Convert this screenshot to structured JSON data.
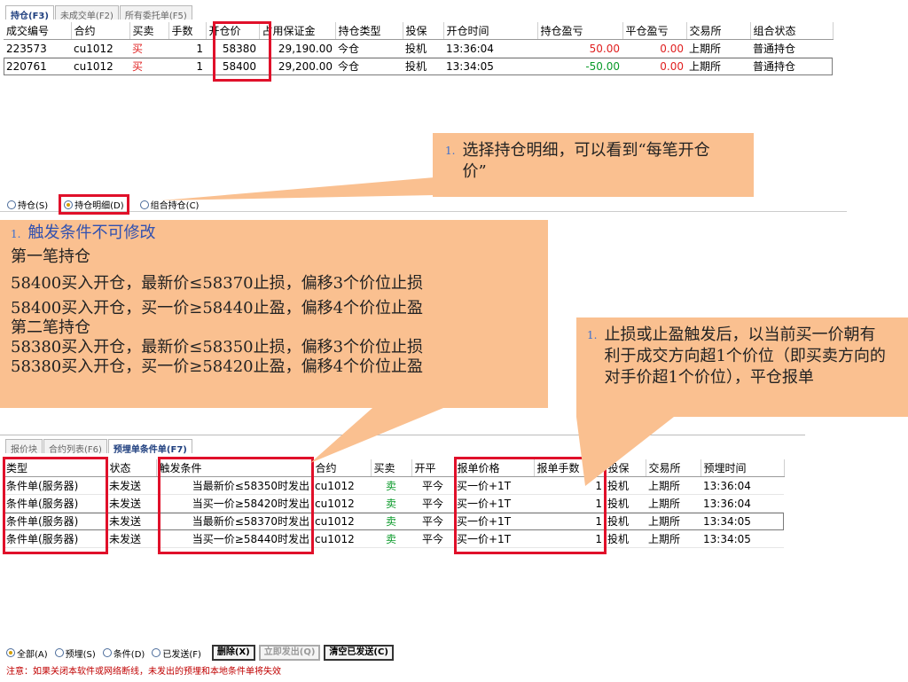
{
  "top_panel": {
    "tabs": [
      {
        "label": "持仓(F3)",
        "active": true
      },
      {
        "label": "未成交单(F2)",
        "active": false
      },
      {
        "label": "所有委托单(F5)",
        "active": false
      }
    ],
    "columns": [
      "成交编号",
      "合约",
      "买卖",
      "手数",
      "开仓价",
      "占用保证金",
      "持仓类型",
      "投保",
      "开仓时间",
      "持仓盈亏",
      "平仓盈亏",
      "交易所",
      "组合状态"
    ],
    "rows": [
      [
        "223573",
        "cu1012",
        "买",
        "1",
        "58380",
        "29,190.00",
        "今仓",
        "投机",
        "13:36:04",
        "50.00",
        "0.00",
        "上期所",
        "普通持仓"
      ],
      [
        "220761",
        "cu1012",
        "买",
        "1",
        "58400",
        "29,200.00",
        "今仓",
        "投机",
        "13:34:05",
        "-50.00",
        "0.00",
        "上期所",
        "普通持仓"
      ]
    ],
    "radios": [
      {
        "label": "持仓(S)",
        "selected": false
      },
      {
        "label": "持仓明细(D)",
        "selected": true
      },
      {
        "label": "组合持仓(C)",
        "selected": false
      }
    ]
  },
  "callout_1": {
    "num": "1.",
    "text": "选择持仓明细，可以看到“每笔开仓价”"
  },
  "callout_2": {
    "num": "1.",
    "title": "触发条件不可修改",
    "lines": [
      "第一笔持仓",
      "58400买入开仓，最新价≤58370止损，偏移3个价位止损",
      "58400买入开仓，买一价≥58440止盈，偏移4个价位止盈",
      "第二笔持仓",
      "58380买入开仓，最新价≤58350止损，偏移3个价位止损",
      "58380买入开仓，买一价≥58420止盈，偏移4个价位止盈"
    ]
  },
  "callout_3": {
    "num": "1.",
    "text": "止损或止盈触发后，以当前买一价朝有利于成交方向超1个价位（即买卖方向的对手价超1个价位），平仓报单"
  },
  "bottom_panel": {
    "tabs": [
      {
        "label": "报价块",
        "active": false
      },
      {
        "label": "合约列表(F6)",
        "active": false
      },
      {
        "label": "预埋单条件单(F7)",
        "active": true
      }
    ],
    "columns": [
      "类型",
      "状态",
      "触发条件",
      "合约",
      "买卖",
      "开平",
      "报单价格",
      "报单手数",
      "投保",
      "交易所",
      "预埋时间"
    ],
    "rows": [
      [
        "条件单(服务器)",
        "未发送",
        "当最新价≤58350时发出",
        "cu1012",
        "卖",
        "平今",
        "买一价+1T",
        "1",
        "投机",
        "上期所",
        "13:36:04"
      ],
      [
        "条件单(服务器)",
        "未发送",
        "当买一价≥58420时发出",
        "cu1012",
        "卖",
        "平今",
        "买一价+1T",
        "1",
        "投机",
        "上期所",
        "13:36:04"
      ],
      [
        "条件单(服务器)",
        "未发送",
        "当最新价≤58370时发出",
        "cu1012",
        "卖",
        "平今",
        "买一价+1T",
        "1",
        "投机",
        "上期所",
        "13:34:05"
      ],
      [
        "条件单(服务器)",
        "未发送",
        "当买一价≥58440时发出",
        "cu1012",
        "卖",
        "平今",
        "买一价+1T",
        "1",
        "投机",
        "上期所",
        "13:34:05"
      ]
    ],
    "radios": [
      {
        "label": "全部(A)",
        "selected": true
      },
      {
        "label": "预埋(S)",
        "selected": false
      },
      {
        "label": "条件(D)",
        "selected": false
      },
      {
        "label": "已发送(F)",
        "selected": false
      }
    ],
    "buttons": [
      {
        "label": "删除(X)",
        "enabled": true
      },
      {
        "label": "立即发出(Q)",
        "enabled": false
      },
      {
        "label": "清空已发送(C)",
        "enabled": true
      }
    ],
    "warning": "注意：如果关闭本软件或网络断线，未发出的预埋和本地条件单将失效"
  },
  "colors": {
    "callout": "#fac090",
    "highlight": "#e0102a",
    "buy": "#e02020",
    "sell": "#0a9a2a"
  }
}
